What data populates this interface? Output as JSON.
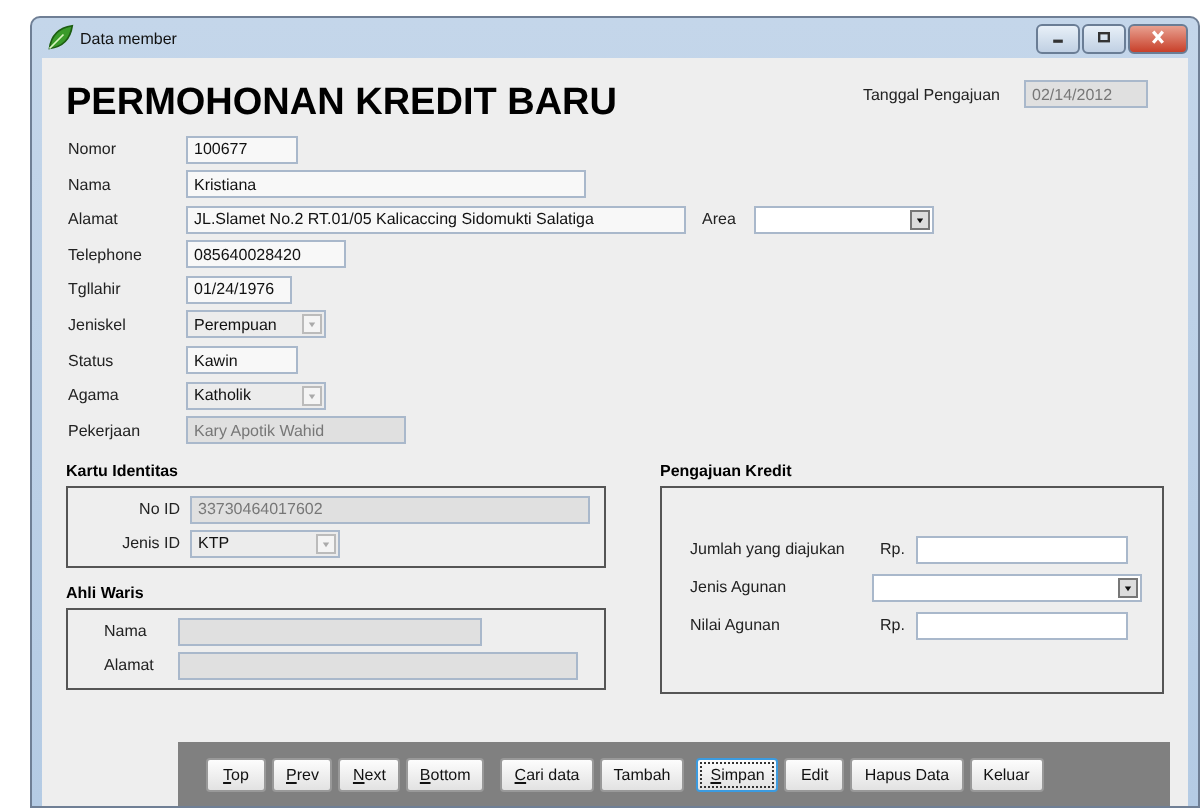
{
  "window": {
    "title": "Data member"
  },
  "heading": "PERMOHONAN KREDIT BARU",
  "submission_date": {
    "label": "Tanggal Pengajuan",
    "value": "02/14/2012",
    "disabled": true
  },
  "fields": [
    {
      "label": "Nomor",
      "kind": "text",
      "value": "100677",
      "disabled": false
    },
    {
      "label": "Nama",
      "kind": "text",
      "value": "Kristiana",
      "disabled": false
    },
    {
      "label": "Alamat",
      "kind": "text",
      "value": "JL.Slamet No.2 RT.01/05 Kalicaccing Sidomukti Salatiga",
      "disabled": false,
      "side": {
        "label": "Area",
        "kind": "combo",
        "disabled": false
      }
    },
    {
      "label": "Telephone",
      "kind": "text",
      "value": "085640028420",
      "disabled": false
    },
    {
      "label": "Tgllahir",
      "kind": "text",
      "value": "01/24/1976",
      "disabled": false
    },
    {
      "label": "Jeniskel",
      "kind": "combo",
      "value": "Perempuan",
      "disabled": true
    },
    {
      "label": "Status",
      "kind": "text",
      "value": "Kawin",
      "disabled": false
    },
    {
      "label": "Agama",
      "kind": "combo",
      "value": "Katholik",
      "disabled": true
    },
    {
      "label": "Pekerjaan",
      "kind": "text",
      "value": "Kary Apotik Wahid",
      "disabled": true
    }
  ],
  "identity_card": {
    "title": "Kartu Identitas",
    "fields": [
      {
        "label": "No ID",
        "kind": "text",
        "value": "33730464017602",
        "disabled": true
      },
      {
        "label": "Jenis ID",
        "kind": "combo",
        "value": "KTP",
        "disabled": true
      }
    ]
  },
  "heir": {
    "title": "Ahli Waris",
    "fields": [
      {
        "label": "Nama",
        "kind": "text",
        "disabled": true
      },
      {
        "label": "Alamat",
        "kind": "text",
        "disabled": true
      }
    ]
  },
  "credit": {
    "title": "Pengajuan Kredit",
    "fields": [
      {
        "label": "Jumlah yang diajukan",
        "prefix": "Rp.",
        "kind": "text",
        "disabled": false
      },
      {
        "label": "Jenis Agunan",
        "kind": "combo",
        "disabled": false
      },
      {
        "label": "Nilai Agunan",
        "prefix": "Rp.",
        "kind": "text",
        "disabled": false
      }
    ]
  },
  "buttons": [
    {
      "label": "Top",
      "mnemonic": true,
      "focused": false
    },
    {
      "label": "Prev",
      "mnemonic": true,
      "focused": false
    },
    {
      "label": "Next",
      "mnemonic": true,
      "focused": false
    },
    {
      "label": "Bottom",
      "mnemonic": true,
      "focused": false
    },
    {
      "label": "Cari data",
      "mnemonic": true,
      "focused": false
    },
    {
      "label": "Tambah",
      "mnemonic": false,
      "focused": false
    },
    {
      "label": "Simpan",
      "mnemonic": true,
      "focused": true
    },
    {
      "label": "Edit",
      "mnemonic": false,
      "focused": false
    },
    {
      "label": "Hapus Data",
      "mnemonic": false,
      "focused": false
    },
    {
      "label": "Keluar",
      "mnemonic": false,
      "focused": false
    }
  ]
}
